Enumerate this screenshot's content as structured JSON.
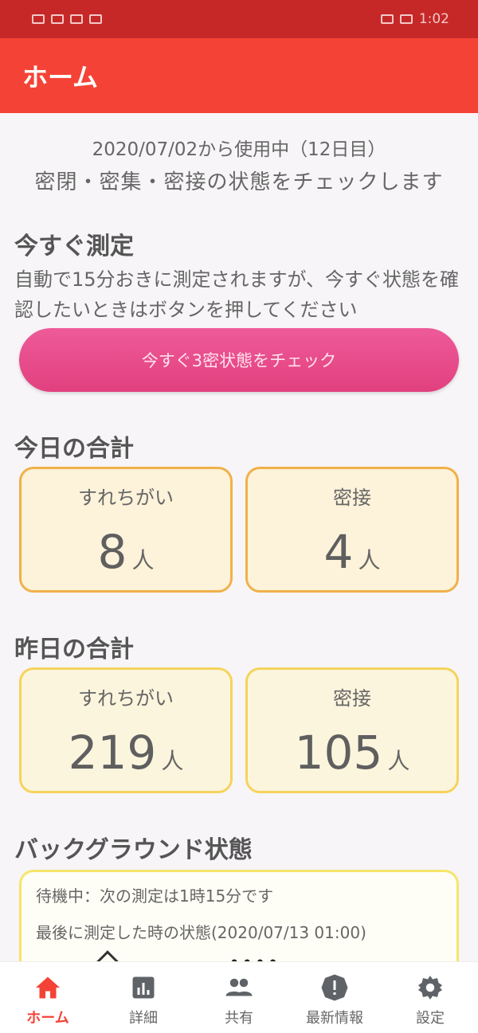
{
  "status_bar": {
    "left_text": "ᅵ ᅵ ᅵ",
    "time": "1:02"
  },
  "app_bar": {
    "title": "ホーム"
  },
  "home": {
    "usage": "2020/07/02から使用中（12日目）",
    "tagline": "密閉・密集・密接の状態をチェックします"
  },
  "measure_now": {
    "title": "今すぐ測定",
    "description": "自動で15分おきに測定されますが、今すぐ状態を確認したいときはボタンを押してください",
    "button_label": "今すぐ3密状態をチェック"
  },
  "today": {
    "title": "今日の合計",
    "passing_label": "すれちがい",
    "passing_value": "8",
    "close_label": "密接",
    "close_value": "4",
    "unit": "人"
  },
  "yesterday": {
    "title": "昨日の合計",
    "passing_label": "すれちがい",
    "passing_value": "219",
    "close_label": "密接",
    "close_value": "105",
    "unit": "人"
  },
  "background": {
    "title": "バックグラウンド状態",
    "waiting_text": "待機中：次の測定は1時15分です",
    "last_state_text": "最後に測定した時の状態(2020/07/13 01:00)"
  },
  "nav": {
    "items": [
      {
        "label": "ホーム",
        "icon": "home-icon",
        "active": true
      },
      {
        "label": "詳細",
        "icon": "chart-icon",
        "active": false
      },
      {
        "label": "共有",
        "icon": "people-icon",
        "active": false
      },
      {
        "label": "最新情報",
        "icon": "alert-icon",
        "active": false
      },
      {
        "label": "設定",
        "icon": "gear-icon",
        "active": false
      }
    ]
  },
  "colors": {
    "status_bar": "#c62828",
    "app_bar": "#f44336",
    "button": "#e2407f",
    "card_border_today": "#f0b149",
    "card_border_yesterday": "#f6d35c",
    "nav_active": "#f44336"
  }
}
